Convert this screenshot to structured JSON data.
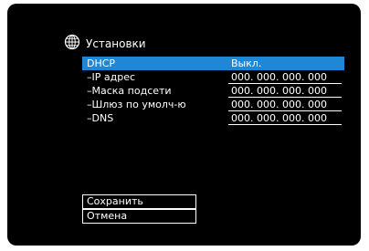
{
  "header": {
    "title": "Установки",
    "icon": "globe-icon"
  },
  "settings": [
    {
      "label": "DHCP",
      "value": "Выкл.",
      "selected": true
    },
    {
      "label": "–IP адрес",
      "value": "000. 000. 000. 000"
    },
    {
      "label": "–Маска подсети",
      "value": "000. 000. 000. 000"
    },
    {
      "label": "–Шлюз по умолч-ю",
      "value": "000. 000. 000. 000"
    },
    {
      "label": "–DNS",
      "value": "000. 000. 000. 000"
    }
  ],
  "buttons": {
    "save": "Сохранить",
    "cancel": "Отмена"
  },
  "colors": {
    "background": "#000000",
    "highlight": "#1f88d6",
    "text": "#ffffff"
  }
}
